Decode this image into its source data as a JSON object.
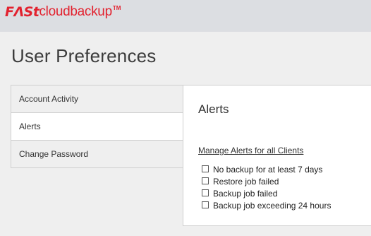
{
  "header": {
    "logo": {
      "part1": "FΛSt",
      "part2": "cloudbackup",
      "tm": "TM"
    }
  },
  "page": {
    "title": "User Preferences"
  },
  "sidebar": {
    "items": [
      {
        "label": "Account Activity",
        "active": false
      },
      {
        "label": "Alerts",
        "active": true
      },
      {
        "label": "Change Password",
        "active": false
      }
    ]
  },
  "panel": {
    "title": "Alerts",
    "manage_link": "Manage Alerts for all Clients",
    "options": [
      {
        "label": "No backup for at least 7 days",
        "checked": false
      },
      {
        "label": "Restore job failed",
        "checked": false
      },
      {
        "label": "Backup job failed",
        "checked": false
      },
      {
        "label": "Backup job exceeding 24 hours",
        "checked": false
      }
    ]
  },
  "colors": {
    "brand": "#e2222f",
    "topbar": "#dcdee2",
    "background": "#efefef"
  }
}
